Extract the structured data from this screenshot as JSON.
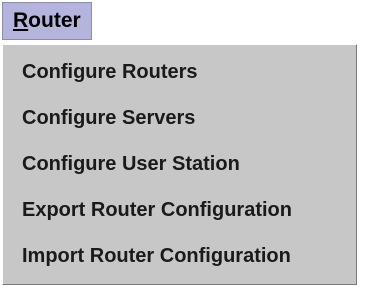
{
  "menubar": {
    "title_first_letter": "R",
    "title_rest": "outer"
  },
  "menu": {
    "items": [
      {
        "label": "Configure Routers"
      },
      {
        "label": "Configure Servers"
      },
      {
        "label": "Configure User Station"
      },
      {
        "label": "Export Router Configuration"
      },
      {
        "label": "Import Router Configuration"
      }
    ]
  },
  "colors": {
    "menu_title_bg": "#b4b4dc",
    "dropdown_bg": "#c7c7c7"
  }
}
